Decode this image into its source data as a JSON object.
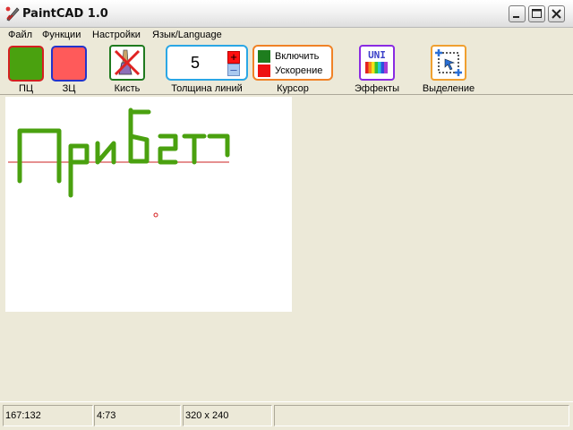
{
  "window": {
    "title": "PaintCAD 1.0",
    "controls": [
      "minimize",
      "maximize",
      "close"
    ]
  },
  "menu": {
    "items": [
      "Файл",
      "Функции",
      "Настройки",
      "Язык/Language"
    ]
  },
  "toolbar": {
    "primary_color": {
      "label": "ПЦ",
      "color": "#4aa10f"
    },
    "secondary_color": {
      "label": "ЗЦ",
      "color": "#ff5a5a"
    },
    "brush": {
      "label": "Кисть",
      "icon": "crossed-brush-icon"
    },
    "line_thickness": {
      "label": "Толщина линий",
      "value": "5",
      "plus": "+",
      "minus": "–"
    },
    "cursor": {
      "label": "Курсор",
      "options": [
        {
          "label": "Включить",
          "color": "#1e7d1e"
        },
        {
          "label": "Ускорение",
          "color": "#ee1111"
        }
      ]
    },
    "effects": {
      "label": "Эффекты",
      "icon_text": "UNI"
    },
    "selection": {
      "label": "Выделение",
      "icon": "selection-icon"
    }
  },
  "canvas": {
    "stroke_color": "#4aa10f",
    "guide_color": "#cc2222"
  },
  "statusbar": {
    "cells": [
      "167:132",
      "4:73",
      "320 x 240",
      ""
    ]
  }
}
